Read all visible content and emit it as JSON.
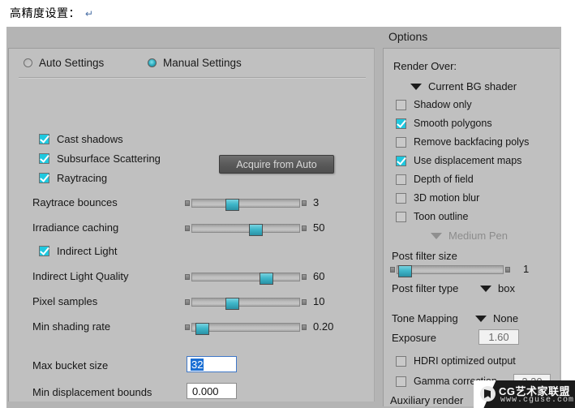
{
  "document": {
    "caption": "高精度设置：",
    "pilcrow": "↵"
  },
  "colors": {
    "panel_bg": "#c0c0c0",
    "header_band": "#b4b4b4",
    "accent_cyan": "#1fc8df",
    "slider_handle": "#3fb6c9",
    "selection_blue": "#1b6fd4",
    "button_dark": "#5a5a5a"
  },
  "header": {
    "options_title": "Options"
  },
  "left_panel": {
    "modes": [
      {
        "label": "Auto Settings",
        "selected": false,
        "icon": "radio-icon"
      },
      {
        "label": "Manual Settings",
        "selected": true,
        "icon": "radio-icon"
      }
    ],
    "acquire_button": "Acquire from Auto",
    "checkboxes": [
      {
        "label": "Cast shadows",
        "checked": true
      },
      {
        "label": "Subsurface Scattering",
        "checked": true
      },
      {
        "label": "Raytracing",
        "checked": true
      }
    ],
    "indirect_light": {
      "label": "Indirect Light",
      "checked": true
    },
    "sliders": [
      {
        "label": "Raytrace bounces",
        "value": "3",
        "fill_pct": 31
      },
      {
        "label": "Irradiance caching",
        "value": "50",
        "fill_pct": 53
      },
      {
        "label": "Indirect Light Quality",
        "value": "60",
        "fill_pct": 63
      },
      {
        "label": "Pixel samples",
        "value": "10",
        "fill_pct": 31
      },
      {
        "label": "Min shading rate",
        "value": "0.20",
        "fill_pct": 5
      }
    ],
    "fields": [
      {
        "label": "Max bucket size",
        "value": "32",
        "focused": true
      },
      {
        "label": "Min displacement bounds",
        "value": "0.000",
        "focused": false
      }
    ]
  },
  "right_panel": {
    "render_over_label": "Render Over:",
    "render_over_value": "Current BG shader",
    "options": [
      {
        "label": "Shadow only",
        "checked": false
      },
      {
        "label": "Smooth polygons",
        "checked": true
      },
      {
        "label": "Remove backfacing polys",
        "checked": false
      },
      {
        "label": "Use displacement maps",
        "checked": true
      },
      {
        "label": "Depth of field",
        "checked": false
      },
      {
        "label": "3D motion blur",
        "checked": false
      },
      {
        "label": "Toon outline",
        "checked": false
      }
    ],
    "toon_pen_value": "Medium Pen",
    "post_filter_size_label": "Post filter size",
    "post_filter_size_value": "1",
    "post_filter_size_fill_pct": 4,
    "post_filter_type_label": "Post filter type",
    "post_filter_type_value": "box",
    "tone_mapping_label": "Tone Mapping",
    "tone_mapping_value": "None",
    "exposure_label": "Exposure",
    "exposure_value": "1.60",
    "hdri_label": "HDRI optimized output",
    "hdri_checked": false,
    "gamma_label": "Gamma correction",
    "gamma_checked": false,
    "gamma_value": "2.20",
    "auxiliary_label": "Auxiliary render"
  },
  "watermark": {
    "name": "CG艺术家联盟",
    "url": "www.cguse.com"
  }
}
